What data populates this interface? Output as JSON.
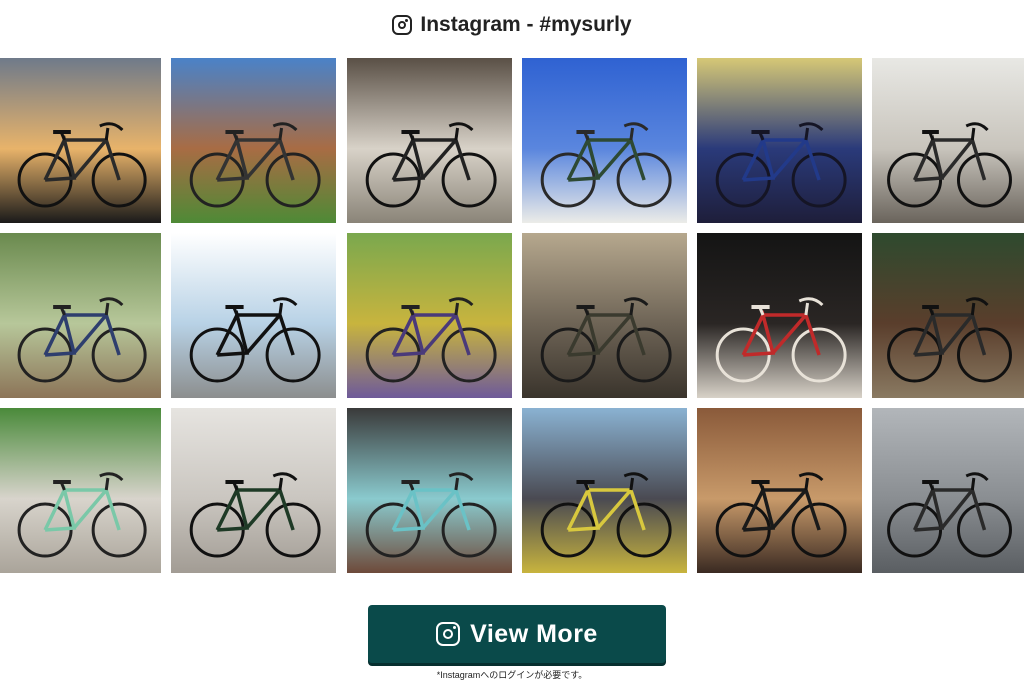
{
  "header": {
    "title": "Instagram - #mysurly",
    "icon": "instagram-icon"
  },
  "photos": [
    {
      "name": "photo-sunset-road-bike",
      "colors": [
        "#6f7a8a",
        "#e8b36a",
        "#1a1a1a"
      ],
      "frame": "#2a2a2a",
      "img": "#111111"
    },
    {
      "name": "photo-rock-cliff-bike",
      "colors": [
        "#4a82c8",
        "#a86c44",
        "#4e8a36"
      ],
      "frame": "#333333",
      "img": "#222222"
    },
    {
      "name": "photo-orange-bag-garage",
      "colors": [
        "#5a5046",
        "#d8d2c8",
        "#8a8478"
      ],
      "frame": "#222222",
      "img": "#111111"
    },
    {
      "name": "photo-blue-sky-wall",
      "colors": [
        "#2f62d2",
        "#5a86de",
        "#ecece8"
      ],
      "frame": "#2e4a34",
      "img": "#2a2a2a"
    },
    {
      "name": "photo-blue-surly-frame",
      "colors": [
        "#d6c876",
        "#2a3a7a",
        "#1e1e3a"
      ],
      "frame": "#223a8a",
      "img": "#151525"
    },
    {
      "name": "photo-basket-bikes",
      "colors": [
        "#e8e8e4",
        "#c8c4bc",
        "#6a645c"
      ],
      "frame": "#2a2a2a",
      "img": "#111111"
    },
    {
      "name": "photo-bamboo-forest",
      "colors": [
        "#6a8a4e",
        "#b7c79a",
        "#8c7458"
      ],
      "frame": "#2e3e6e",
      "img": "#222222"
    },
    {
      "name": "photo-bike-on-path",
      "colors": [
        "#ffffff",
        "#b8d2e6",
        "#8c8e8e"
      ],
      "frame": "#111111",
      "img": "#111111"
    },
    {
      "name": "photo-stone-trough",
      "colors": [
        "#7aa84e",
        "#c8b43e",
        "#6e5a9a"
      ],
      "frame": "#4a3a7a",
      "img": "#222222"
    },
    {
      "name": "photo-fat-bike-tan",
      "colors": [
        "#b6a88e",
        "#6e6456",
        "#3a342c"
      ],
      "frame": "#3a3a2e",
      "img": "#1a1a1a"
    },
    {
      "name": "photo-night-red-bikes",
      "colors": [
        "#141414",
        "#2a2624",
        "#d8d2c8"
      ],
      "frame": "#c02a2a",
      "img": "#e8e2d8"
    },
    {
      "name": "photo-red-pannier",
      "colors": [
        "#2e4a2e",
        "#5a3e2c",
        "#8a7a62"
      ],
      "frame": "#2a2a2a",
      "img": "#111111"
    },
    {
      "name": "photo-rider-helmet",
      "colors": [
        "#4a8a3a",
        "#d8d4cc",
        "#aaa49a"
      ],
      "frame": "#7ac8a8",
      "img": "#222222"
    },
    {
      "name": "photo-green-touring",
      "colors": [
        "#e6e4e0",
        "#cac6c0",
        "#a29c94"
      ],
      "frame": "#1e3a26",
      "img": "#111111"
    },
    {
      "name": "photo-teal-surly-temple",
      "colors": [
        "#3a3a3a",
        "#8acace",
        "#6e4a3a"
      ],
      "frame": "#6ac2c6",
      "img": "#222222"
    },
    {
      "name": "photo-fat-bikes-yellow",
      "colors": [
        "#8ab2d2",
        "#4a4a52",
        "#c8b43e"
      ],
      "frame": "#d8c83e",
      "img": "#111111"
    },
    {
      "name": "photo-wooden-deck-bike",
      "colors": [
        "#8a5a3a",
        "#c89a6a",
        "#3a2a22"
      ],
      "frame": "#1a1a1a",
      "img": "#111111"
    },
    {
      "name": "photo-front-bags-street",
      "colors": [
        "#b2b6ba",
        "#8a8e92",
        "#5a5e62"
      ],
      "frame": "#2a2a2a",
      "img": "#111111"
    }
  ],
  "view_more": {
    "label": "View More",
    "icon": "instagram-icon"
  },
  "note": "*Instagramへのログインが必要です。"
}
